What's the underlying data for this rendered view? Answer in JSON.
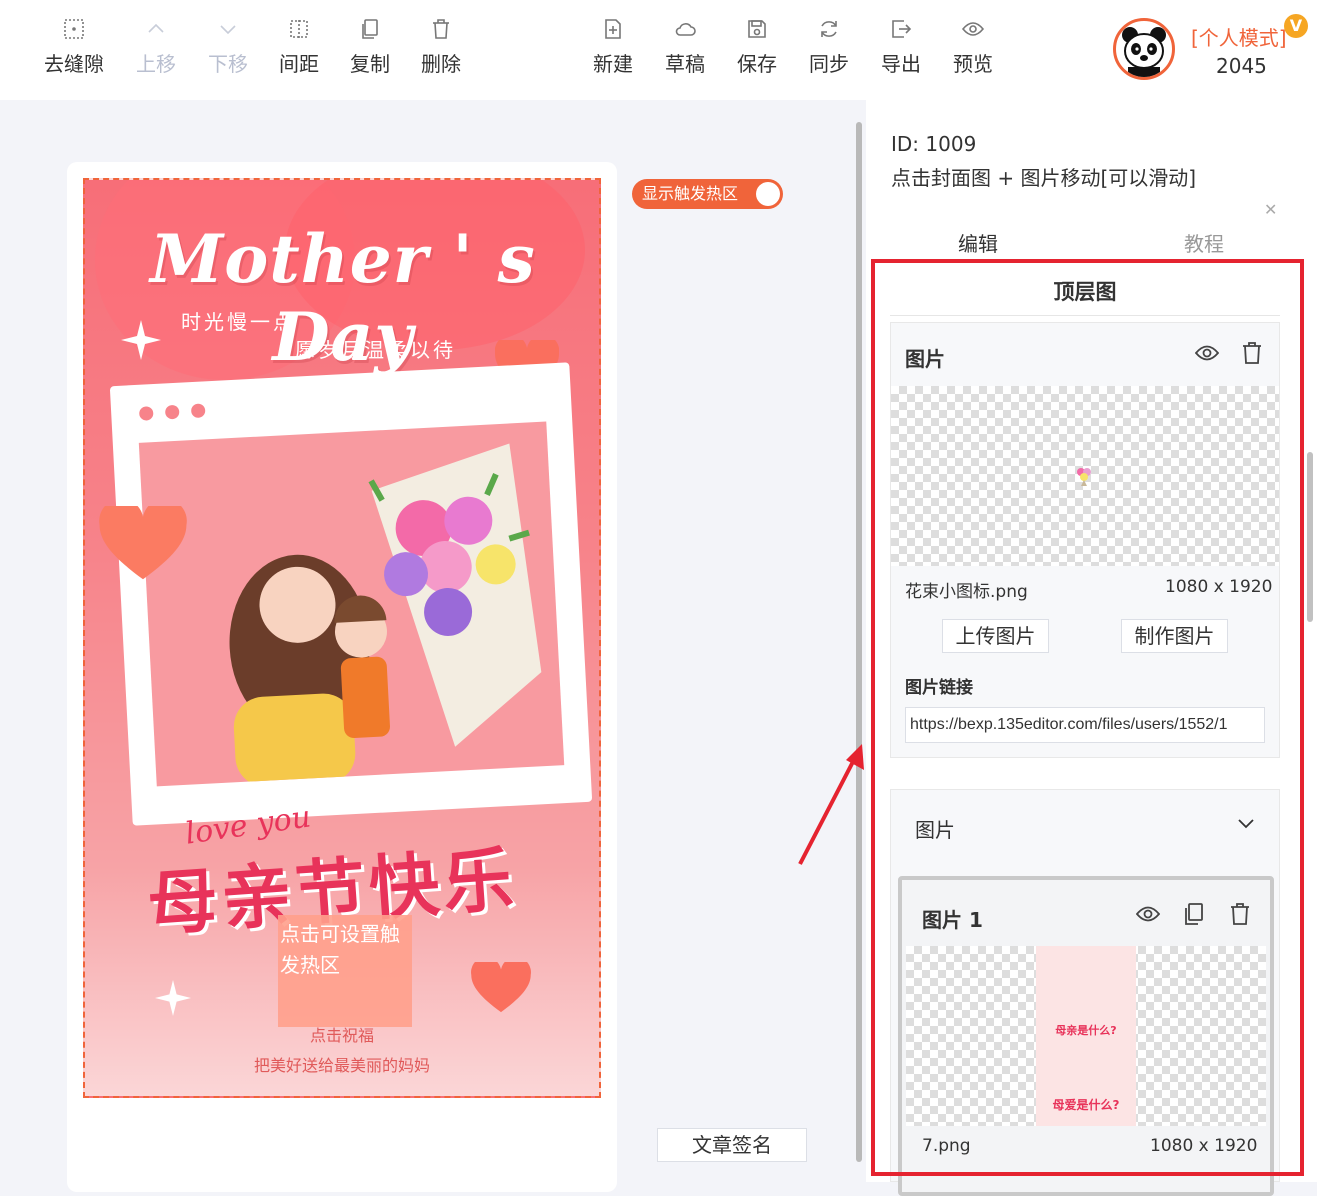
{
  "toolbar": {
    "left_buttons": [
      {
        "label": "去缝隙",
        "icon": "grid-dots-icon",
        "disabled": false
      },
      {
        "label": "上移",
        "icon": "chevron-up-icon",
        "disabled": true
      },
      {
        "label": "下移",
        "icon": "chevron-down-icon",
        "disabled": true
      },
      {
        "label": "间距",
        "icon": "spacing-icon",
        "disabled": false
      },
      {
        "label": "复制",
        "icon": "copy-icon",
        "disabled": false
      },
      {
        "label": "删除",
        "icon": "trash-icon",
        "disabled": false
      }
    ],
    "right_buttons": [
      {
        "label": "新建",
        "icon": "file-plus-icon"
      },
      {
        "label": "草稿",
        "icon": "cloud-icon"
      },
      {
        "label": "保存",
        "icon": "save-icon"
      },
      {
        "label": "同步",
        "icon": "sync-icon"
      },
      {
        "label": "导出",
        "icon": "export-icon"
      },
      {
        "label": "预览",
        "icon": "eye-icon"
      }
    ]
  },
  "user": {
    "mode": "[个人模式]",
    "vip_badge": "V",
    "count": "2045"
  },
  "canvas": {
    "toggle_label": "显示触发热区",
    "poster": {
      "title": "Mother ' s Day",
      "subtitle1": "时光慢一点",
      "subtitle2": "愿岁月温柔以待",
      "love_text": "love you",
      "big_text": "母亲节快乐",
      "hotspot_text": "点击可设置触发热区",
      "wish1": "点击祝福",
      "wish2": "把美好送给最美丽的妈妈"
    },
    "sign_button": "文章签名"
  },
  "panel": {
    "id_text": "ID: 1009",
    "description": "点击封面图 + 图片移动[可以滑动]",
    "tabs": [
      {
        "label": "编辑",
        "active": true
      },
      {
        "label": "教程",
        "active": false
      }
    ],
    "section_title": "顶层图",
    "image_block": {
      "heading": "图片",
      "file_name": "花束小图标.png",
      "file_size": "1080 x 1920",
      "upload_label": "上传图片",
      "make_label": "制作图片",
      "link_label": "图片链接",
      "link_value": "https://bexp.135editor.com/files/users/1552/1"
    },
    "image_list": {
      "heading": "图片",
      "item": {
        "heading": "图片 1",
        "thumb_title": "母亲是什么?",
        "thumb_title2": "母爱是什么?",
        "file_name": "7.png",
        "file_size": "1080 x 1920"
      }
    }
  },
  "colors": {
    "accent": "#f0643a",
    "highlight_box": "#e52330",
    "poster_pink": "#f7838a"
  }
}
